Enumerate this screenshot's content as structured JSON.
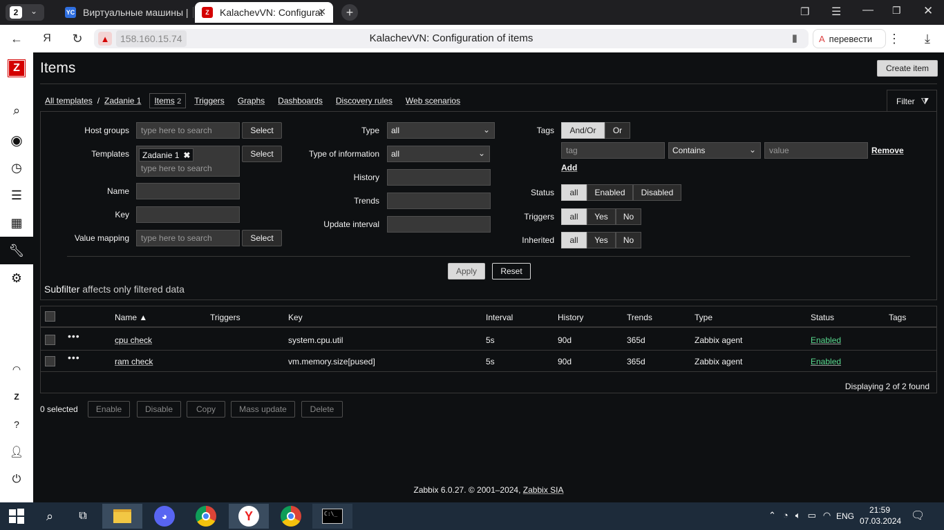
{
  "browser": {
    "tab_count": "2",
    "tabs": [
      {
        "icon": "YC",
        "icon_color": "#2f6fe0",
        "title": "Виртуальные машины | Ya"
      },
      {
        "icon": "Z",
        "icon_color": "#d40000",
        "title": "KalachevVN: Configurati"
      }
    ],
    "address": "158.160.15.74",
    "page_title": "KalachevVN: Configuration of items",
    "translate_label": "перевести"
  },
  "sidebar": {
    "logo": "Z",
    "icons": [
      "search-icon",
      "eye-icon",
      "stopwatch-icon",
      "list-icon",
      "chart-icon",
      "wrench-icon",
      "gear-icon",
      "headset-icon",
      "zabbix-share-icon",
      "help-icon",
      "user-icon",
      "power-icon"
    ]
  },
  "header": {
    "title": "Items",
    "create_button": "Create item"
  },
  "breadcrumb": {
    "all_templates": "All templates",
    "separator": "/",
    "template": "Zadanie 1",
    "items": "Items",
    "items_count": "2",
    "links": [
      "Triggers",
      "Graphs",
      "Dashboards",
      "Discovery rules",
      "Web scenarios"
    ],
    "filter": "Filter"
  },
  "filter": {
    "host_groups_label": "Host groups",
    "host_groups_placeholder": "type here to search",
    "templates_label": "Templates",
    "templates_chip": "Zadanie 1",
    "templates_placeholder": "type here to search",
    "name_label": "Name",
    "key_label": "Key",
    "value_mapping_label": "Value mapping",
    "value_mapping_placeholder": "type here to search",
    "select": "Select",
    "type_label": "Type",
    "type_value": "all",
    "type_info_label": "Type of information",
    "type_info_value": "all",
    "history_label": "History",
    "trends_label": "Trends",
    "update_interval_label": "Update interval",
    "tags_label": "Tags",
    "andor": "And/Or",
    "or": "Or",
    "tag_placeholder": "tag",
    "contains": "Contains",
    "value_placeholder": "value",
    "remove": "Remove",
    "add": "Add",
    "status_label": "Status",
    "status_opts": [
      "all",
      "Enabled",
      "Disabled"
    ],
    "triggers_label": "Triggers",
    "inherited_label": "Inherited",
    "yesno_opts": [
      "all",
      "Yes",
      "No"
    ],
    "apply": "Apply",
    "reset": "Reset",
    "subfilter_bold": "Subfilter",
    "subfilter_rest": "affects only filtered data"
  },
  "table": {
    "headers": {
      "name": "Name ▲",
      "triggers": "Triggers",
      "key": "Key",
      "interval": "Interval",
      "history": "History",
      "trends": "Trends",
      "type": "Type",
      "status": "Status",
      "tags": "Tags"
    },
    "rows": [
      {
        "name": "cpu check",
        "key": "system.cpu.util",
        "interval": "5s",
        "history": "90d",
        "trends": "365d",
        "type": "Zabbix agent",
        "status": "Enabled"
      },
      {
        "name": "ram check",
        "key": "vm.memory.size[pused]",
        "interval": "5s",
        "history": "90d",
        "trends": "365d",
        "type": "Zabbix agent",
        "status": "Enabled"
      }
    ],
    "footer": "Displaying 2 of 2 found"
  },
  "actions": {
    "selected": "0 selected",
    "buttons": [
      "Enable",
      "Disable",
      "Copy",
      "Mass update",
      "Delete"
    ]
  },
  "footer": {
    "text": "Zabbix 6.0.27. © 2001–2024,",
    "link": "Zabbix SIA"
  },
  "taskbar": {
    "lang": "ENG",
    "time": "21:59",
    "date": "07.03.2024"
  },
  "colors": {
    "status_enabled": "#59db8f",
    "zabbix_red": "#d40000"
  }
}
